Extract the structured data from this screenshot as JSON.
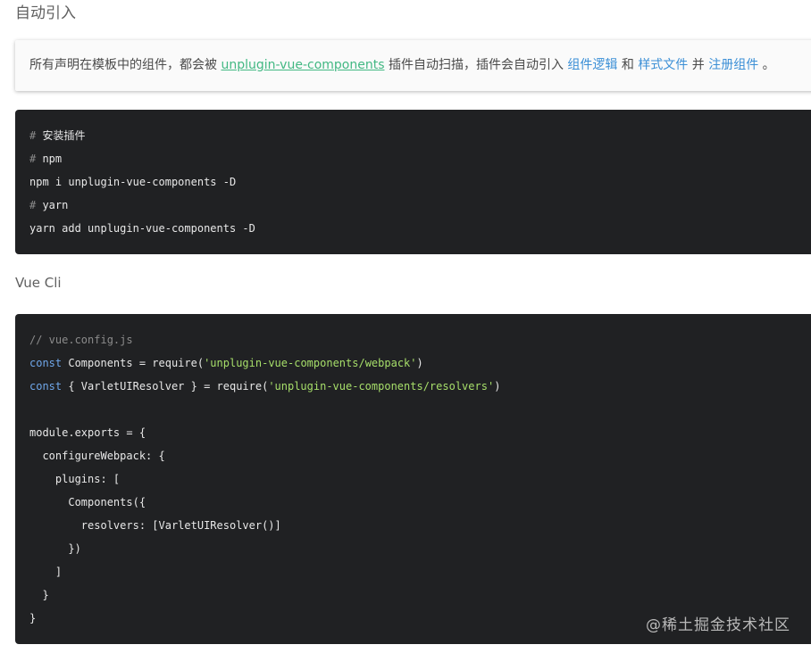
{
  "heading": "自动引入",
  "notice": {
    "text_before": "所有声明在模板中的组件，都会被 ",
    "plugin_link": "unplugin-vue-components",
    "text_middle": " 插件自动扫描，插件会自动引入 ",
    "logic_link": "组件逻辑",
    "text_and": " 和 ",
    "style_link": "样式文件",
    "text_also": " 并 ",
    "register_link": "注册组件",
    "text_end": " 。"
  },
  "install_code": {
    "lines": [
      {
        "hash": "# ",
        "text": "安装插件"
      },
      {
        "hash": "# ",
        "text": "npm"
      },
      {
        "hash": "",
        "text": "npm i unplugin-vue-components -D"
      },
      {
        "hash": "# ",
        "text": "yarn"
      },
      {
        "hash": "",
        "text": "yarn add unplugin-vue-components -D"
      }
    ]
  },
  "subheading": "Vue Cli",
  "config_code": {
    "line1_comment": "// vue.config.js",
    "line2_kw": "const",
    "line2_mid": " Components = require(",
    "line2_str": "'unplugin-vue-components/webpack'",
    "line2_end": ")",
    "line3_kw": "const",
    "line3_mid": " { VarletUIResolver } = require(",
    "line3_str": "'unplugin-vue-components/resolvers'",
    "line3_end": ")",
    "line4": "",
    "line5": "module.exports = {",
    "line6": "  configureWebpack: {",
    "line7": "    plugins: [",
    "line8": "      Components({",
    "line9": "        resolvers: [VarletUIResolver()]",
    "line10": "      })",
    "line11": "    ]",
    "line12": "  }",
    "line13": "}"
  },
  "watermark": "@稀土掘金技术社区"
}
